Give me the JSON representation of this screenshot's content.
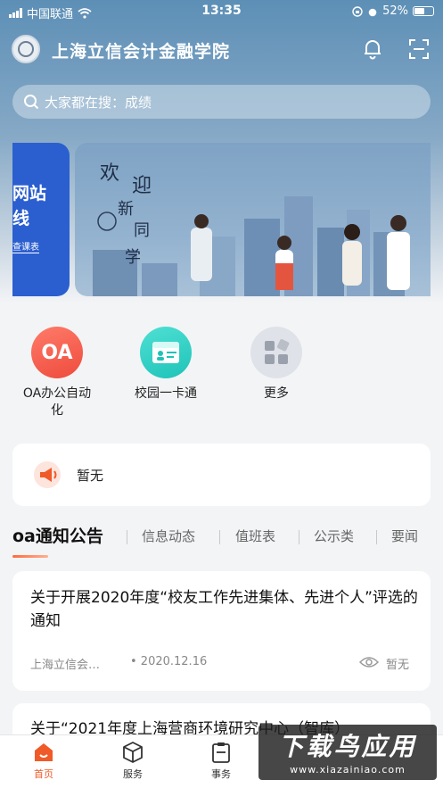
{
  "status_bar": {
    "carrier": "中国联通",
    "time": "13:35",
    "battery": "52%"
  },
  "header": {
    "title": "上海立信会计金融学院",
    "bell_icon": "bell-icon",
    "scan_icon": "scan-icon"
  },
  "search": {
    "placeholder": "大家都在搜：成绩"
  },
  "banner": {
    "side_line1": "网站",
    "side_line2": "线",
    "side_line3": "查课表",
    "main_w1": "欢",
    "main_w2": "迎",
    "main_w3": "新",
    "main_w4": "同",
    "main_w5": "学"
  },
  "quick_actions": [
    {
      "label": "OA办公自动化",
      "icon_text": "OA",
      "icon": "oa-icon"
    },
    {
      "label": "校园一卡通",
      "icon": "id-card-icon"
    },
    {
      "label": "更多",
      "icon": "grid-icon"
    }
  ],
  "notice": {
    "text": "暂无",
    "icon": "megaphone-icon"
  },
  "tabs": [
    "oa通知公告",
    "信息动态",
    "值班表",
    "公示类",
    "要闻"
  ],
  "news": [
    {
      "title": "关于开展2020年度“校友工作先进集体、先进个人”评选的通知",
      "source": "上海立信会…",
      "date": "• 2020.12.16",
      "views": "暂无"
    },
    {
      "title": "关于“2021年度上海营商环境研究中心（智库）"
    }
  ],
  "tabbar": [
    {
      "label": "首页",
      "icon": "home-icon"
    },
    {
      "label": "服务",
      "icon": "cube-icon"
    },
    {
      "label": "事务",
      "icon": "clipboard-icon"
    }
  ],
  "watermark": {
    "line1": "下载鸟应用",
    "line2": "www.xiazainiao.com"
  },
  "colors": {
    "accent": "#f05a28",
    "header_bg": "#5d8fb6"
  }
}
